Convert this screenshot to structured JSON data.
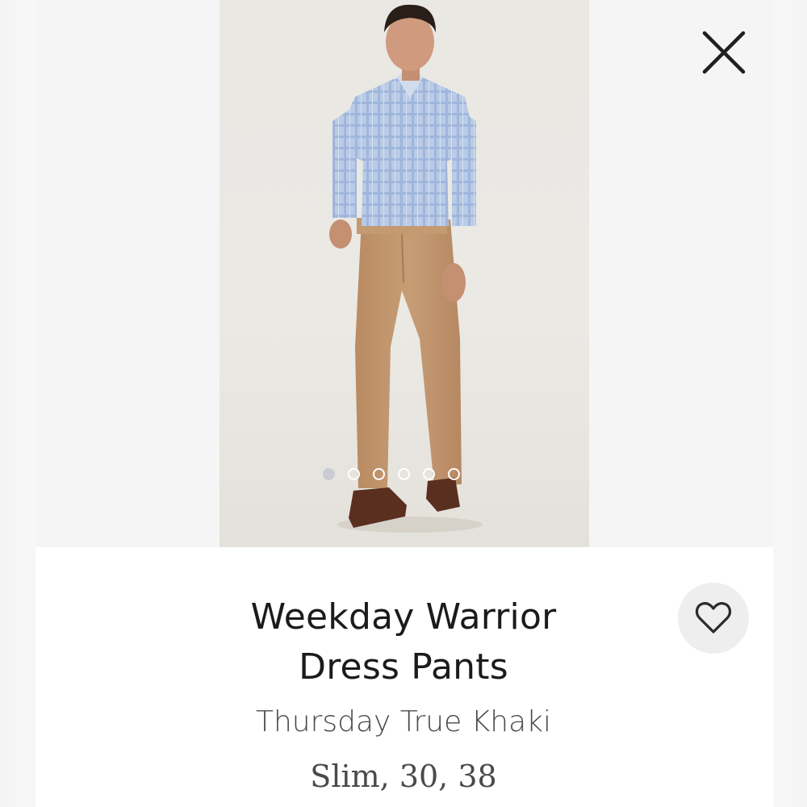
{
  "product": {
    "title_line1": "Weekday Warrior",
    "title_line2": "Dress Pants",
    "color_name": "Thursday True Khaki",
    "variant": "Slim, 30, 38"
  },
  "gallery": {
    "image_count": 6,
    "active_index": 0
  },
  "icons": {
    "close": "close-icon",
    "favorite": "heart-outline-icon"
  },
  "colors": {
    "background": "#f7f7f7",
    "card": "#ffffff",
    "text_primary": "#1b1b1b",
    "text_secondary": "#4a4a4a",
    "favorite_bg": "#eeeeee",
    "dot_active": "#c9ccd3"
  }
}
